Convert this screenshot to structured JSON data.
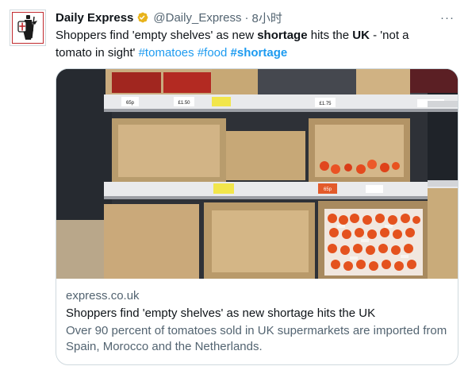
{
  "tweet": {
    "author_name": "Daily Express",
    "handle": "@Daily_Express",
    "separator": "·",
    "time": "8小时",
    "more_label": "···",
    "text_parts": {
      "p1": "Shoppers find 'empty shelves' as new ",
      "b1": "shortage",
      "p2": " hits the ",
      "b2": "UK",
      "p3": " - 'not a tomato in sight' "
    },
    "hashtags": [
      "#tomatoes",
      "#food",
      "#shortage"
    ]
  },
  "card": {
    "domain": "express.co.uk",
    "title": "Shoppers find 'empty shelves' as new shortage hits the UK",
    "description": "Over 90 percent of tomatoes sold in UK supermarkets are imported from Spain, Morocco and the Netherlands.",
    "price_labels": [
      "65p",
      "£1.50",
      "£1.75",
      "65p"
    ]
  },
  "colors": {
    "accent": "#1d9bf0",
    "verified_gold": "#e8b31c",
    "brand_red": "#c0282d"
  },
  "icons": {
    "avatar": "crusader-knight-logo",
    "verified": "verified-badge-icon",
    "more": "more-options-icon"
  }
}
